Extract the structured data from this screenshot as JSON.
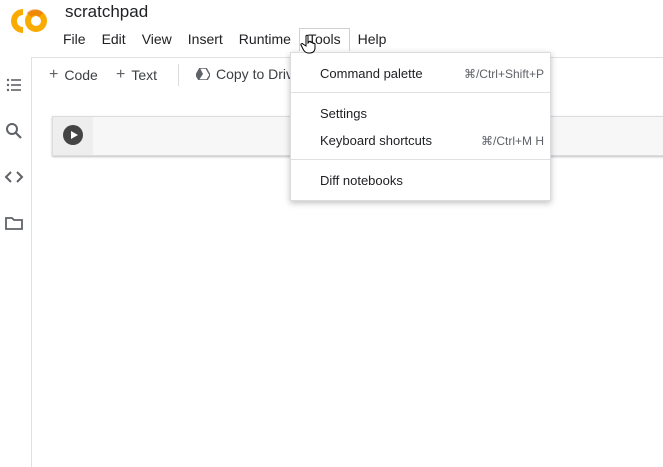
{
  "app": {
    "title": "scratchpad",
    "logo_text": "CO",
    "logo_color": "#F9AB00",
    "logo_color_secondary": "#E8710A"
  },
  "menubar": {
    "items": [
      {
        "label": "File"
      },
      {
        "label": "Edit"
      },
      {
        "label": "View"
      },
      {
        "label": "Insert"
      },
      {
        "label": "Runtime"
      },
      {
        "label": "Tools",
        "active": true
      },
      {
        "label": "Help"
      }
    ]
  },
  "toolbar": {
    "code_label": "Code",
    "text_label": "Text",
    "copy_to_drive_label": "Copy to Drive",
    "plus_icon": "plus-icon",
    "drive_icon": "drive-icon"
  },
  "leftrail": {
    "icons": [
      "table-of-contents-icon",
      "search-icon",
      "code-snippets-icon",
      "files-icon"
    ]
  },
  "cell": {
    "run_icon": "play-icon"
  },
  "tools_menu": {
    "items": [
      {
        "label": "Command palette",
        "shortcut": "⌘/Ctrl+Shift+P"
      },
      {
        "label": "Settings",
        "shortcut": ""
      },
      {
        "label": "Keyboard shortcuts",
        "shortcut": "⌘/Ctrl+M H"
      },
      {
        "label": "Diff notebooks",
        "shortcut": ""
      }
    ]
  }
}
